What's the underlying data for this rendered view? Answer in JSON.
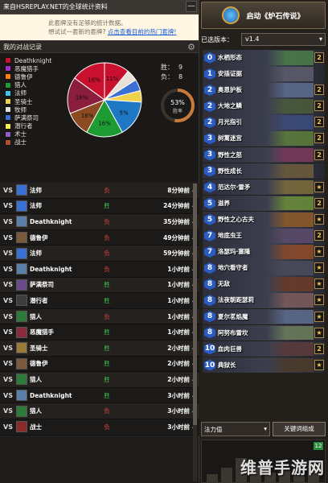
{
  "header": {
    "title": "来自HSREPLAY.NET的全球统计资料",
    "minimize": "—"
  },
  "notice": {
    "line1": "此套牌没有足够的统计数据。",
    "line2": "想试试一套新的套牌?",
    "link": "点击查看目前的热门套牌!"
  },
  "stats": {
    "title": "我的对战记录",
    "legend": [
      {
        "label": "Deathknight",
        "color": "#c9102e"
      },
      {
        "label": "恶魔猎手",
        "color": "#a330c9"
      },
      {
        "label": "德鲁伊",
        "color": "#ff7d0a"
      },
      {
        "label": "猎人",
        "color": "#1e9b33"
      },
      {
        "label": "法师",
        "color": "#3fc7eb"
      },
      {
        "label": "圣骑士",
        "color": "#f0d24a"
      },
      {
        "label": "牧师",
        "color": "#e0e0e0"
      },
      {
        "label": "萨满祭司",
        "color": "#3a6fd6"
      },
      {
        "label": "潜行者",
        "color": "#f5f04b"
      },
      {
        "label": "术士",
        "color": "#8b5ec9"
      },
      {
        "label": "战士",
        "color": "#b24d2e"
      }
    ],
    "pie_labels": [
      "11%",
      "5%",
      "16%",
      "16%",
      "16%",
      "16%"
    ],
    "wins_label": "胜：",
    "wins": "9",
    "losses_label": "负：",
    "losses": "8",
    "winrate_value": "53%",
    "winrate_label": "胜率"
  },
  "pie_data": [
    {
      "pct": 11,
      "color": "#c9102e"
    },
    {
      "pct": 5,
      "color": "#e8e2d6"
    },
    {
      "pct": 5,
      "color": "#3a6fd6"
    },
    {
      "pct": 5,
      "color": "#f0d24a"
    },
    {
      "pct": 16,
      "color": "#1e78c4"
    },
    {
      "pct": 16,
      "color": "#1e9b33"
    },
    {
      "pct": 11,
      "color": "#8b4a22"
    },
    {
      "pct": 16,
      "color": "#8b1e3d"
    },
    {
      "pct": 15,
      "color": "#c9102e"
    }
  ],
  "games": [
    {
      "cls": "法师",
      "res": "负",
      "dur": "8分钟前",
      "win": false,
      "c": "#3a6fd6"
    },
    {
      "cls": "法师",
      "res": "胜",
      "dur": "24分钟前",
      "win": true,
      "c": "#3a6fd6"
    },
    {
      "cls": "Deathknight",
      "res": "负",
      "dur": "35分钟前",
      "win": false,
      "c": "#5a7fa8"
    },
    {
      "cls": "德鲁伊",
      "res": "负",
      "dur": "49分钟前",
      "win": false,
      "c": "#7a5a3a"
    },
    {
      "cls": "法师",
      "res": "负",
      "dur": "59分钟前",
      "win": false,
      "c": "#3a6fd6"
    },
    {
      "cls": "Deathknight",
      "res": "负",
      "dur": "1小时前",
      "win": false,
      "c": "#5a7fa8"
    },
    {
      "cls": "萨满祭司",
      "res": "胜",
      "dur": "1小时前",
      "win": true,
      "c": "#6a4a8a"
    },
    {
      "cls": "潜行者",
      "res": "胜",
      "dur": "1小时前",
      "win": true,
      "c": "#3d3d3d"
    },
    {
      "cls": "猎人",
      "res": "负",
      "dur": "1小时前",
      "win": false,
      "c": "#2e7a3a"
    },
    {
      "cls": "恶魔猎手",
      "res": "胜",
      "dur": "1小时前",
      "win": true,
      "c": "#8a2a3a"
    },
    {
      "cls": "圣骑士",
      "res": "胜",
      "dur": "2小时前",
      "win": true,
      "c": "#9a7a3a"
    },
    {
      "cls": "德鲁伊",
      "res": "胜",
      "dur": "2小时前",
      "win": true,
      "c": "#7a5a3a"
    },
    {
      "cls": "猎人",
      "res": "胜",
      "dur": "2小时前",
      "win": true,
      "c": "#2e7a3a"
    },
    {
      "cls": "Deathknight",
      "res": "胜",
      "dur": "3小时前",
      "win": true,
      "c": "#5a7fa8"
    },
    {
      "cls": "猎人",
      "res": "负",
      "dur": "3小时前",
      "win": false,
      "c": "#2e7a3a"
    },
    {
      "cls": "战士",
      "res": "负",
      "dur": "3小时前",
      "win": false,
      "c": "#8a2a2a"
    }
  ],
  "launch": {
    "label": "启动《炉石传说》"
  },
  "version": {
    "label": "已选版本：",
    "value": "v1.4",
    "arrow": "▾"
  },
  "deck": [
    {
      "cost": "0",
      "name": "水栖形态",
      "cnt": "2",
      "art": "#4a7a4a"
    },
    {
      "cost": "1",
      "name": "安插证据",
      "cnt": "",
      "art": "#5a5a6a"
    },
    {
      "cost": "2",
      "name": "奥恩护板",
      "cnt": "2",
      "art": "#5a6a8a"
    },
    {
      "cost": "2",
      "name": "大地之鳞",
      "cnt": "2",
      "art": "#4a5a3a"
    },
    {
      "cost": "2",
      "name": "月光指引",
      "cnt": "2",
      "art": "#3a4a7a"
    },
    {
      "cost": "3",
      "name": "树篱迷宫",
      "cnt": "2",
      "art": "#5a7a3a"
    },
    {
      "cost": "3",
      "name": "野性之怒",
      "cnt": "2",
      "art": "#7a3a5a"
    },
    {
      "cost": "3",
      "name": "野性成长",
      "cnt": "",
      "art": "#6a5a3a"
    },
    {
      "cost": "4",
      "name": "范达尔·雷矛",
      "cnt": "★",
      "art": "#7a6a3a"
    },
    {
      "cost": "5",
      "name": "滋养",
      "cnt": "2",
      "art": "#6a8a3a"
    },
    {
      "cost": "5",
      "name": "野性之心古夫",
      "cnt": "★",
      "art": "#8a5a2a"
    },
    {
      "cost": "7",
      "name": "地底虫王",
      "cnt": "2",
      "art": "#5a4a6a"
    },
    {
      "cost": "7",
      "name": "洛瑟玛·塞隆",
      "cnt": "★",
      "art": "#8a4a2a"
    },
    {
      "cost": "8",
      "name": "地穴看守者",
      "cnt": "★",
      "art": "#4a4a5a"
    },
    {
      "cost": "8",
      "name": "无敌",
      "cnt": "★",
      "art": "#6a3a2a"
    },
    {
      "cost": "8",
      "name": "法夜朝距瑟莉",
      "cnt": "★",
      "art": "#7a5a5a"
    },
    {
      "cost": "8",
      "name": "夏尔茗焰魔",
      "cnt": "★",
      "art": "#5a6a8a"
    },
    {
      "cost": "8",
      "name": "阿努布雷坎",
      "cnt": "★",
      "art": "#6a7a5a"
    },
    {
      "cost": "10",
      "name": "血肉巨兽",
      "cnt": "2",
      "art": "#5a3a3a"
    },
    {
      "cost": "10",
      "name": "典狱长",
      "cnt": "★",
      "art": "#4a3a2a"
    }
  ],
  "filter": {
    "sort_label": "法力值",
    "arrow": "▾",
    "button": "关键词组成"
  },
  "curve": {
    "mark": "12"
  },
  "watermark": "维普手游网"
}
